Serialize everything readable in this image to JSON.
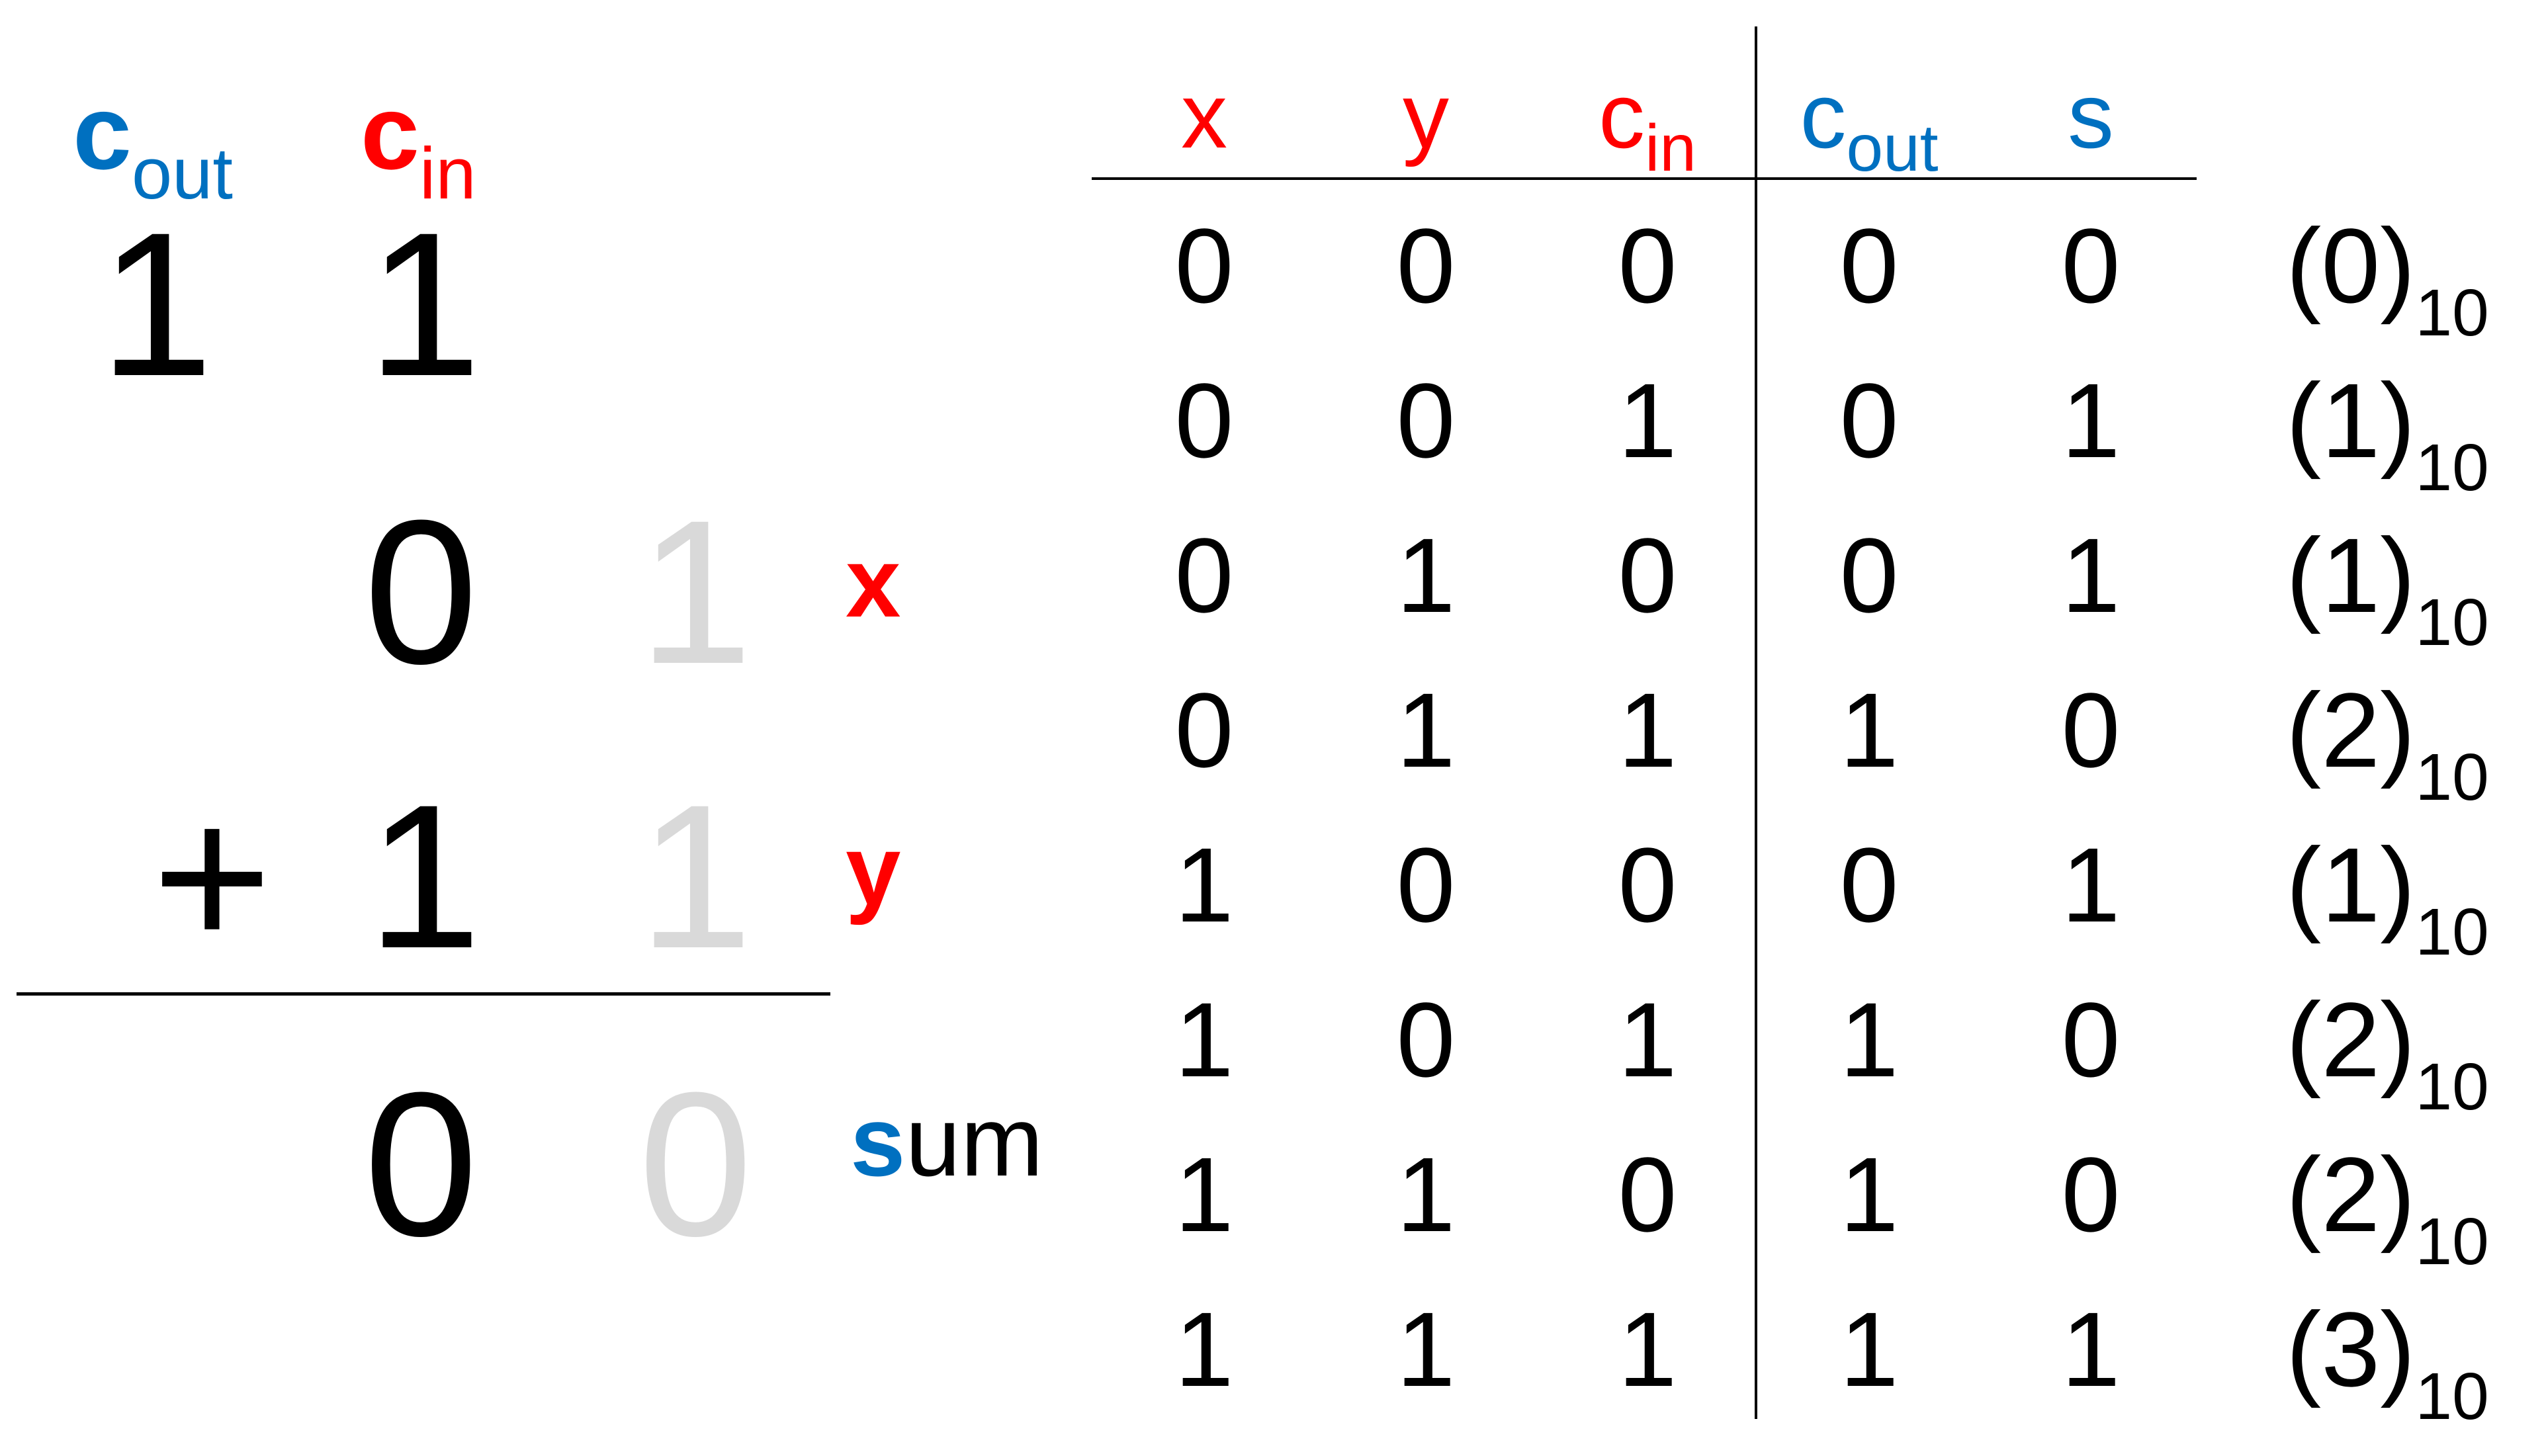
{
  "colors": {
    "input": "#ff0000",
    "output": "#0070c0",
    "faded": "#d9d9d9",
    "text": "#000000"
  },
  "addition": {
    "cout_label": {
      "main": "c",
      "sub": "out"
    },
    "cin_label": {
      "main": "c",
      "sub": "in"
    },
    "carry_digits": [
      "1",
      "1"
    ],
    "x_digits": [
      "0",
      "1"
    ],
    "plus": "+",
    "y_digits": [
      "1",
      "1"
    ],
    "sum_digits": [
      "0",
      "0"
    ],
    "x_label": "x",
    "y_label": "y",
    "sum_label": {
      "highlight": "s",
      "rest": "um"
    }
  },
  "truth_table": {
    "headers": [
      {
        "main": "x",
        "sub": "",
        "color": "input"
      },
      {
        "main": "y",
        "sub": "",
        "color": "input"
      },
      {
        "main": "c",
        "sub": "in",
        "color": "input"
      },
      {
        "main": "c",
        "sub": "out",
        "color": "output"
      },
      {
        "main": "s",
        "sub": "",
        "color": "output"
      }
    ],
    "rows": [
      {
        "cells": [
          "0",
          "0",
          "0",
          "0",
          "0"
        ],
        "dec": "(0)",
        "base": "10"
      },
      {
        "cells": [
          "0",
          "0",
          "1",
          "0",
          "1"
        ],
        "dec": "(1)",
        "base": "10"
      },
      {
        "cells": [
          "0",
          "1",
          "0",
          "0",
          "1"
        ],
        "dec": "(1)",
        "base": "10"
      },
      {
        "cells": [
          "0",
          "1",
          "1",
          "1",
          "0"
        ],
        "dec": "(2)",
        "base": "10"
      },
      {
        "cells": [
          "1",
          "0",
          "0",
          "0",
          "1"
        ],
        "dec": "(1)",
        "base": "10"
      },
      {
        "cells": [
          "1",
          "0",
          "1",
          "1",
          "0"
        ],
        "dec": "(2)",
        "base": "10"
      },
      {
        "cells": [
          "1",
          "1",
          "0",
          "1",
          "0"
        ],
        "dec": "(2)",
        "base": "10"
      },
      {
        "cells": [
          "1",
          "1",
          "1",
          "1",
          "1"
        ],
        "dec": "(3)",
        "base": "10"
      }
    ]
  }
}
